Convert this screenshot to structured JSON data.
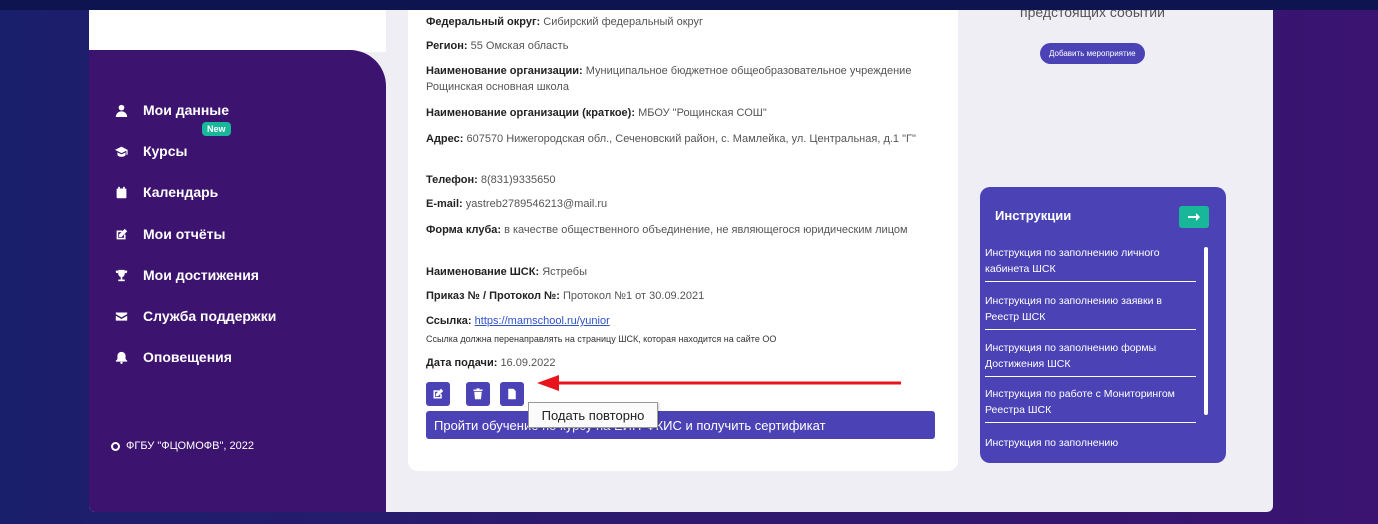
{
  "sidebar": {
    "items": [
      {
        "label": "Мои данные",
        "icon": "user-icon"
      },
      {
        "label": "Курсы",
        "icon": "graduation-cap-icon"
      },
      {
        "label": "Календарь",
        "icon": "calendar-icon"
      },
      {
        "label": "Мои отчёты",
        "icon": "edit-icon"
      },
      {
        "label": "Мои достижения",
        "icon": "trophy-icon"
      },
      {
        "label": "Служба поддержки",
        "icon": "envelope-icon"
      },
      {
        "label": "Оповещения",
        "icon": "bell-icon"
      }
    ],
    "new_badge": "New",
    "copyright": "ФГБУ \"ФЦОМОФВ\", 2022"
  },
  "details": {
    "district": {
      "label": "Федеральный округ:",
      "value": "Сибирский федеральный округ"
    },
    "region": {
      "label": "Регион:",
      "value": "55 Омская область"
    },
    "org_name": {
      "label": "Наименование организации:",
      "value": "Муниципальное бюджетное общеобразовательное учреждение Рощинская основная школа"
    },
    "org_short": {
      "label": "Наименование организации (краткое):",
      "value": "МБОУ \"Рощинская СОШ\""
    },
    "address": {
      "label": "Адрес:",
      "value": "607570 Нижегородская обл., Сеченовский район, с. Мамлейка, ул. Центральная, д.1 \"Г\""
    },
    "phone": {
      "label": "Телефон:",
      "value": "8(831)9335650"
    },
    "email": {
      "label": "E-mail:",
      "value": "yastreb2789546213@mail.ru"
    },
    "club_form": {
      "label": "Форма клуба:",
      "value": "в качестве общественного объединение, не являющегося юридическим лицом"
    },
    "ssk_name": {
      "label": "Наименование ШСК:",
      "value": "Ястребы"
    },
    "order": {
      "label": "Приказ № / Протокол №:",
      "value": "Протокол №1 от 30.09.2021"
    },
    "link": {
      "label": "Ссылка:",
      "value": "https://mamschool.ru/yunior"
    },
    "link_note": "Ссылка должна перенаправлять на страницу ШСК, которая находится на сайте ОО",
    "submit_date": {
      "label": "Дата подачи:",
      "value": "16.09.2022"
    }
  },
  "actions": {
    "tooltip": "Подать повторно",
    "training_button": "Пройти обучение по курсу на ЕИП-ФКИС и получить сертификат",
    "accent_color": "#4b43b5",
    "arrow_color": "#e8141c"
  },
  "events": {
    "title": "предстоящих событий",
    "add_button": "Добавить мероприятие"
  },
  "instructions": {
    "title": "Инструкции",
    "items": [
      "Инструкция по заполнению личного кабинета ШСК",
      "Инструкция по заполнению заявки в Реестр ШСК",
      "Инструкция по заполнению формы Достижения ШСК",
      "Инструкция по работе с Мониторингом Реестра ШСК",
      "Инструкция по заполнению"
    ],
    "arrow_color": "#19b79a"
  }
}
